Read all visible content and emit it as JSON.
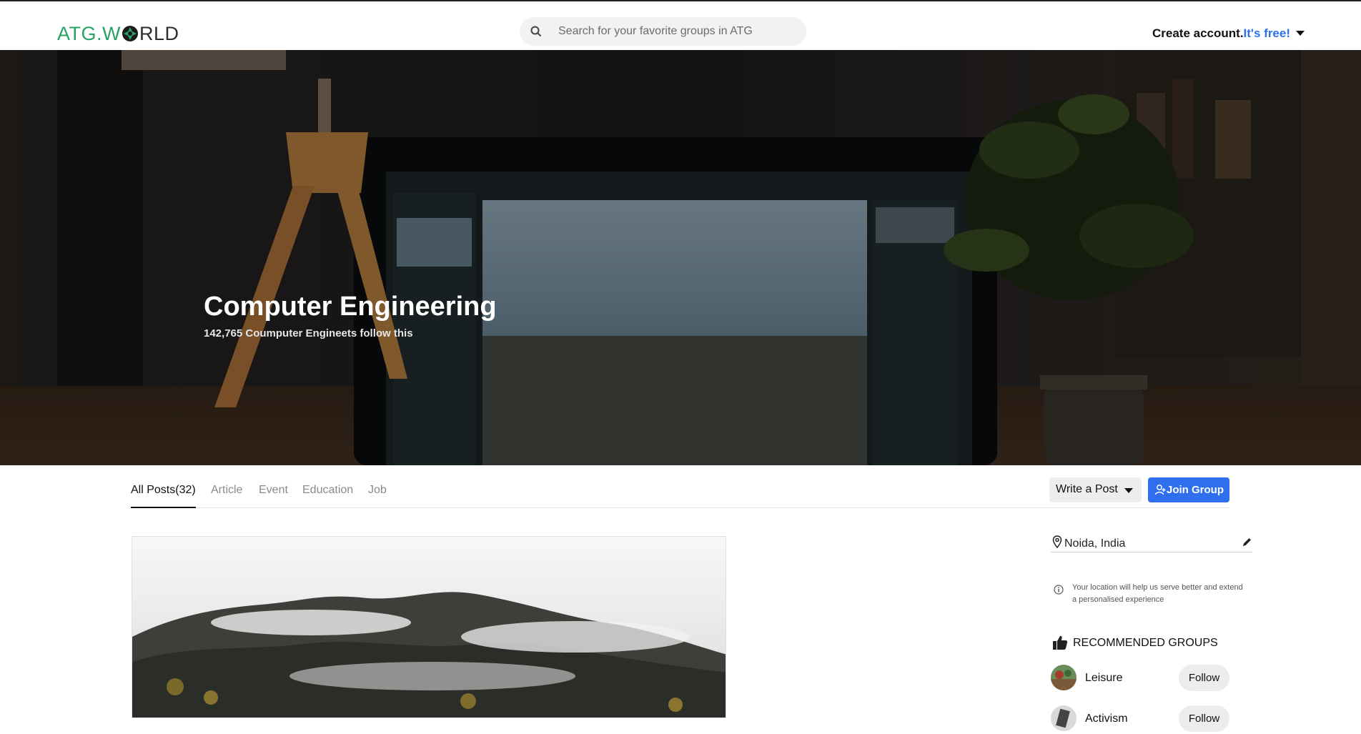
{
  "header": {
    "logo_prefix": "ATG.W",
    "logo_suffix": "RLD",
    "search_placeholder": "Search for your favorite groups in ATG",
    "account_label": "Create account.",
    "account_free": "It's free!"
  },
  "hero": {
    "title": "Computer Engineering",
    "subtitle": "142,765 Coumputer Engineets follow this"
  },
  "tabs": [
    {
      "label": "All Posts(32)",
      "active": true
    },
    {
      "label": "Article",
      "active": false
    },
    {
      "label": "Event",
      "active": false
    },
    {
      "label": "Education",
      "active": false
    },
    {
      "label": "Job",
      "active": false
    }
  ],
  "actions": {
    "write_post": "Write a Post",
    "join_group": "Join Group"
  },
  "sidebar": {
    "location": "Noida, India",
    "location_note": "Your location will help us serve better and extend a personalised experience",
    "recommended_title": "RECOMMENDED GROUPS",
    "groups": [
      {
        "name": "Leisure",
        "follow": "Follow"
      },
      {
        "name": "Activism",
        "follow": "Follow"
      }
    ]
  },
  "colors": {
    "brand_green": "#27a365",
    "accent_blue": "#2f6fed"
  }
}
